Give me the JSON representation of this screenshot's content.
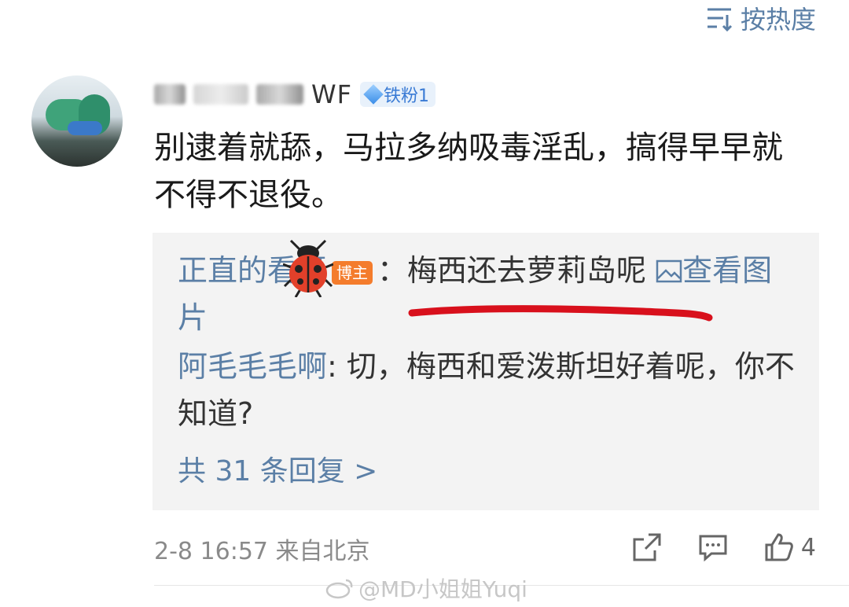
{
  "sort": {
    "label": "按热度",
    "icon": "sort-icon"
  },
  "comment": {
    "username_visible": "WF",
    "fan_badge": "铁粉1",
    "text": "别逮着就舔，马拉多纳吸毒淫乱，搞得早早就不得不退役。",
    "time": "2-8 16:57",
    "location": "来自北京",
    "like_count": "4"
  },
  "replies": [
    {
      "author": "正直的看哥",
      "badge": "博主",
      "text": "：梅西还去萝莉岛呢",
      "link": "查看图片"
    },
    {
      "author": "阿毛毛毛啊",
      "text": ": 切，梅西和爱泼斯坦好着呢，你不知道?"
    }
  ],
  "more_replies": "共 31 条回复 >",
  "watermark": "@MD小姐姐Yuqi",
  "colors": {
    "link": "#5b7fa6",
    "badge_orange": "#f47c2c",
    "highlight_red": "#d8101c"
  }
}
